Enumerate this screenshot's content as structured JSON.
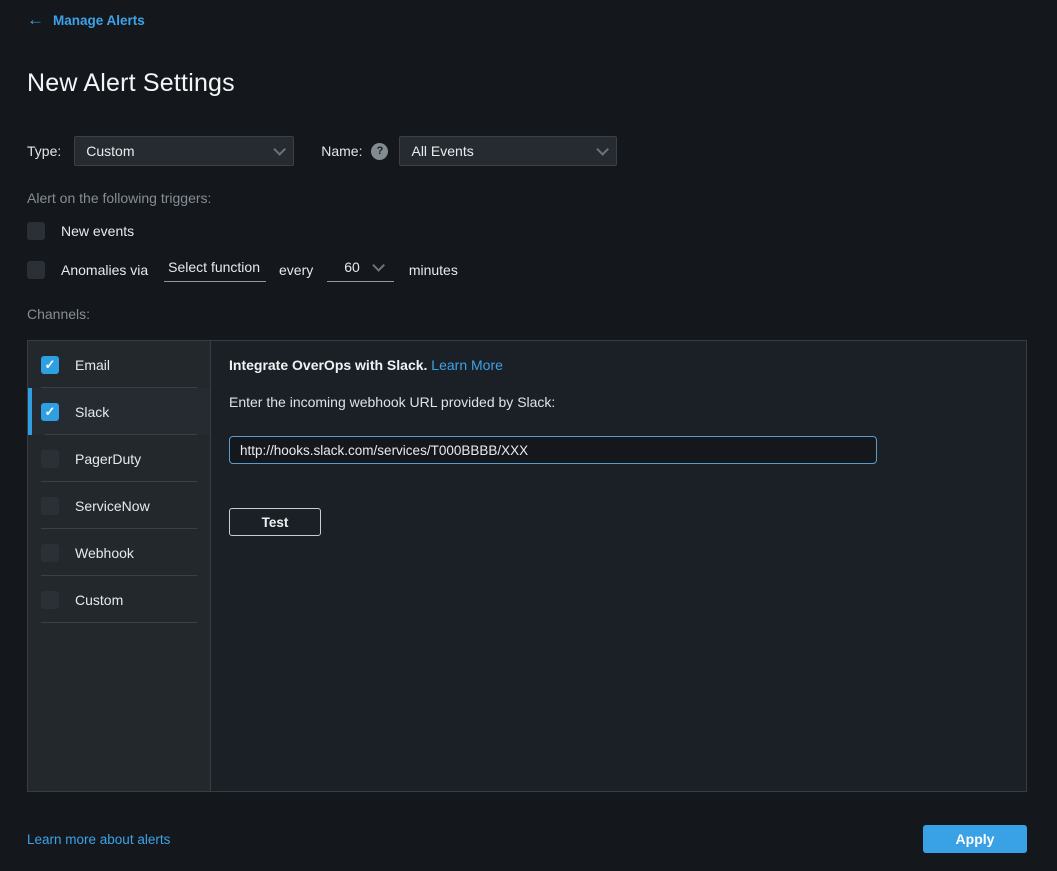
{
  "header": {
    "back_label": "Manage Alerts",
    "title": "New Alert Settings"
  },
  "icons": {
    "back_arrow": "←",
    "help": "?",
    "checkmark": "✓",
    "chevron_down": "▾"
  },
  "type_row": {
    "type_label": "Type:",
    "type_value": "Custom",
    "name_label": "Name:",
    "name_value": "All Events"
  },
  "triggers": {
    "heading": "Alert on the following triggers:",
    "new_events": {
      "label": "New events",
      "checked": false
    },
    "anomalies": {
      "label": "Anomalies via",
      "checked": false,
      "function_value": "Select function",
      "every_label": "every",
      "interval_value": "60",
      "minutes_label": "minutes"
    }
  },
  "channels": {
    "heading": "Channels:",
    "items": [
      {
        "label": "Email",
        "checked": true,
        "selected": false
      },
      {
        "label": "Slack",
        "checked": true,
        "selected": true
      },
      {
        "label": "PagerDuty",
        "checked": false,
        "selected": false
      },
      {
        "label": "ServiceNow",
        "checked": false,
        "selected": false
      },
      {
        "label": "Webhook",
        "checked": false,
        "selected": false
      },
      {
        "label": "Custom",
        "checked": false,
        "selected": false
      }
    ]
  },
  "slack_panel": {
    "intro_bold": "Integrate OverOps with Slack.",
    "learn_more_label": "Learn More",
    "instruction": "Enter the incoming webhook URL provided by Slack:",
    "webhook_url": "http://hooks.slack.com/services/T000BBBB/XXX",
    "test_button_label": "Test"
  },
  "footer": {
    "learn_link_label": "Learn more about alerts",
    "apply_button_label": "Apply"
  },
  "colors": {
    "background": "#14181d",
    "accent_blue": "#39a2e6",
    "link_blue": "#3da2e8",
    "checkbox_checked": "#2e9fe0",
    "panel_border": "#373d43"
  }
}
